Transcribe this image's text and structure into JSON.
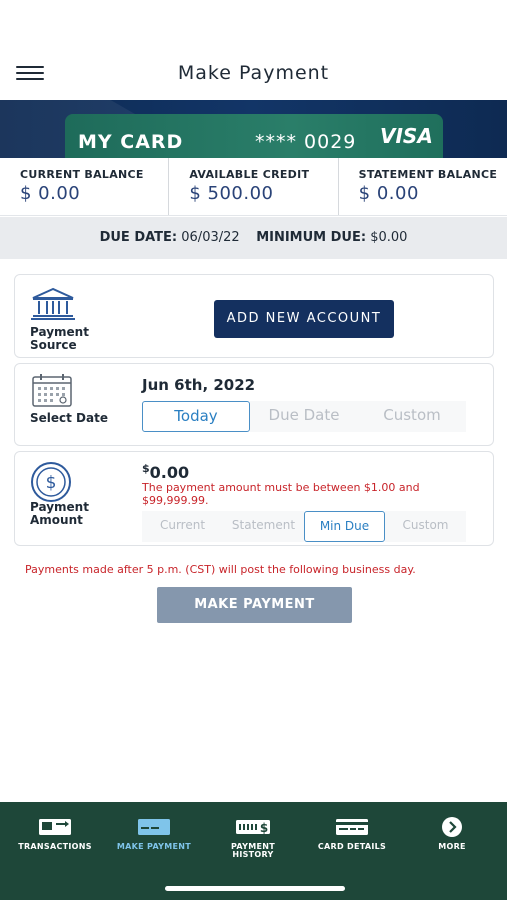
{
  "header": {
    "title": "Make Payment"
  },
  "card": {
    "name": "MY CARD",
    "number": "**** 0029",
    "brand": "VISA"
  },
  "balances": [
    {
      "label": "CURRENT BALANCE",
      "value": "$ 0.00"
    },
    {
      "label": "AVAILABLE CREDIT",
      "value": "$ 500.00"
    },
    {
      "label": "STATEMENT BALANCE",
      "value": "$ 0.00"
    }
  ],
  "due": {
    "due_date_label": "DUE DATE:",
    "due_date_value": "06/03/22",
    "min_due_label": "MINIMUM DUE:",
    "min_due_value": "$0.00"
  },
  "source": {
    "label_line1": "Payment",
    "label_line2": "Source",
    "button": "ADD NEW ACCOUNT"
  },
  "date": {
    "label": "Select Date",
    "selected_text": "Jun 6th, 2022",
    "options": [
      "Today",
      "Due Date",
      "Custom"
    ],
    "active_option": "Today"
  },
  "amount": {
    "label_line1": "Payment",
    "label_line2": "Amount",
    "currency_symbol": "$",
    "value": "0.00",
    "error": "The payment amount must be between $1.00 and $99,999.99.",
    "options": [
      "Current",
      "Statement",
      "Min Due",
      "Custom"
    ],
    "active_option": "Min Due"
  },
  "notice": "Payments made after 5 p.m. (CST) will post the following business day.",
  "submit_label": "MAKE PAYMENT",
  "nav": {
    "items": [
      {
        "label": "TRANSACTIONS",
        "icon": "transactions-icon"
      },
      {
        "label": "MAKE PAYMENT",
        "icon": "make-payment-icon"
      },
      {
        "label": "PAYMENT\nHISTORY",
        "icon": "payment-history-icon"
      },
      {
        "label": "CARD DETAILS",
        "icon": "card-details-icon"
      },
      {
        "label": "MORE",
        "icon": "more-icon"
      }
    ],
    "active": "MAKE PAYMENT"
  },
  "colors": {
    "primary_navy": "#14305f",
    "nav_green": "#1e4739",
    "error_red": "#c8242a",
    "accent_blue": "#2a7fc2"
  }
}
